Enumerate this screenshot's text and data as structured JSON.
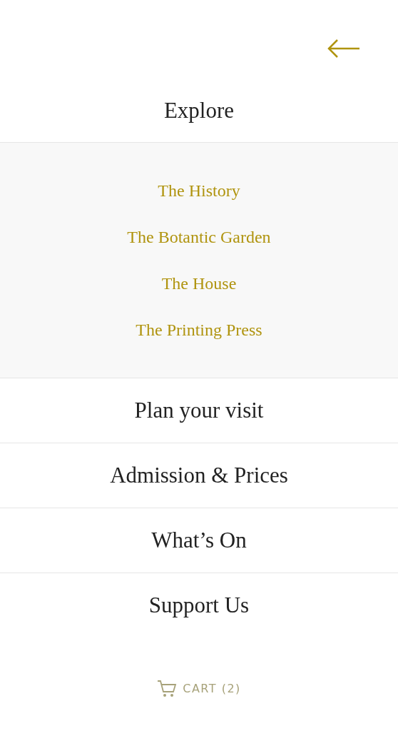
{
  "menu": [
    {
      "label": "Explore",
      "children": [
        {
          "label": "The History"
        },
        {
          "label": "The Botantic Garden"
        },
        {
          "label": "The House"
        },
        {
          "label": "The Printing Press"
        }
      ]
    },
    {
      "label": "Plan your visit"
    },
    {
      "label": "Admission & Prices"
    },
    {
      "label": "What’s On"
    },
    {
      "label": "Support Us"
    }
  ],
  "cart": {
    "label": "CART (2)"
  }
}
